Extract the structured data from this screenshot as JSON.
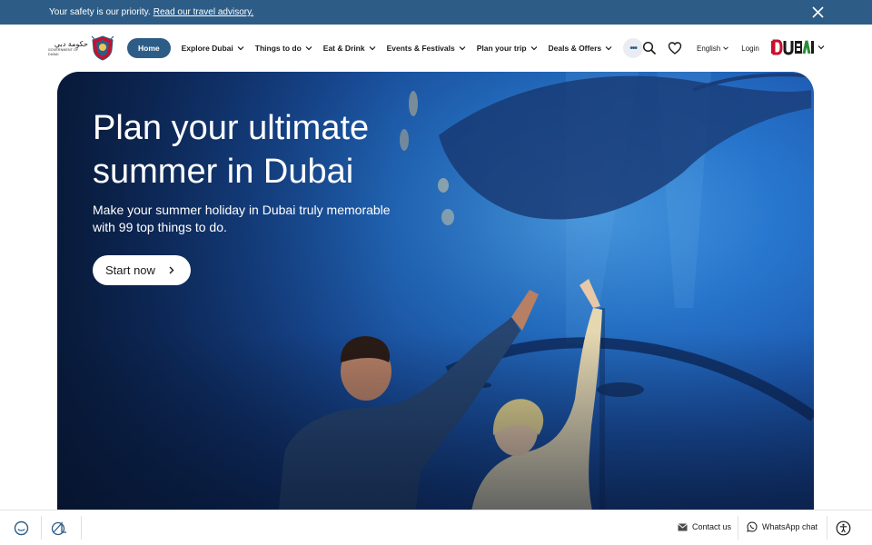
{
  "advisory": {
    "text": "Your safety is our priority.",
    "link": "Read our travel advisory."
  },
  "gov_logo": {
    "arabic": "حكومة دبي",
    "english": "GOVERNMENT OF DUBAI"
  },
  "nav": {
    "home": "Home",
    "items": [
      {
        "label": "Explore Dubai"
      },
      {
        "label": "Things to do"
      },
      {
        "label": "Eat & Drink"
      },
      {
        "label": "Events & Festivals"
      },
      {
        "label": "Plan your trip"
      },
      {
        "label": "Deals & Offers"
      }
    ],
    "more": "•••",
    "language": "English",
    "login": "Login",
    "brand": "DUBAI"
  },
  "hero": {
    "title": "Plan your ultimate summer in Dubai",
    "subtitle": "Make your summer holiday in Dubai truly memorable with 99 top things to do.",
    "cta": "Start now"
  },
  "footer": {
    "contact": "Contact us",
    "whatsapp": "WhatsApp chat"
  },
  "colors": {
    "brand_blue": "#2d5d86",
    "brand_red": "#c8102e"
  },
  "icons": [
    "close-icon",
    "chevron-down-icon",
    "more-icon",
    "search-icon",
    "heart-icon",
    "chevron-right-icon",
    "chat-icon",
    "assistant-icon",
    "mail-icon",
    "whatsapp-icon",
    "accessibility-icon"
  ]
}
